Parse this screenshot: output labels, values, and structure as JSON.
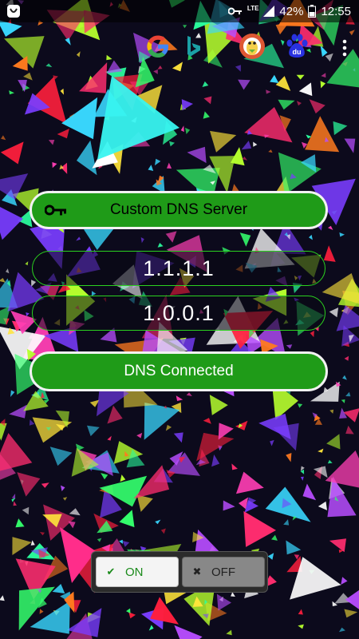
{
  "status_bar": {
    "network": "LTE",
    "battery": "42%",
    "time": "12:55"
  },
  "toolbar": {
    "icons": [
      "google-icon",
      "bing-icon",
      "duckduckgo-icon",
      "baidu-icon",
      "more-options-icon"
    ],
    "baidu_text": "du"
  },
  "custom_button": {
    "label": "Custom DNS Server"
  },
  "dns": {
    "primary": "1.1.1.1",
    "secondary": "1.0.0.1"
  },
  "status_button": {
    "label": "DNS Connected"
  },
  "toggle": {
    "on_label": "ON",
    "off_label": "OFF",
    "on_mark": "✔",
    "off_mark": "✖",
    "selected": "ON"
  },
  "colors": {
    "accent_green": "#1f9b18",
    "outline_green": "#2bd11f"
  }
}
